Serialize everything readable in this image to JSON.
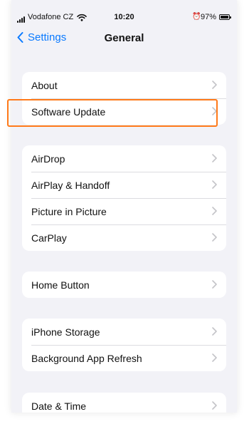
{
  "status_bar": {
    "carrier": "Vodafone CZ",
    "time": "10:20",
    "battery": "97%",
    "battery_level": 0.97
  },
  "nav": {
    "back_label": "Settings",
    "title": "General"
  },
  "groups": [
    {
      "items": [
        "About",
        "Software Update"
      ]
    },
    {
      "items": [
        "AirDrop",
        "AirPlay & Handoff",
        "Picture in Picture",
        "CarPlay"
      ]
    },
    {
      "items": [
        "Home Button"
      ]
    },
    {
      "items": [
        "iPhone Storage",
        "Background App Refresh"
      ]
    },
    {
      "items": [
        "Date & Time"
      ]
    }
  ],
  "highlighted_item": "Software Update",
  "colors": {
    "accent": "#0a7aff",
    "highlight": "#ff7a1a",
    "background": "#f2f2f7"
  }
}
